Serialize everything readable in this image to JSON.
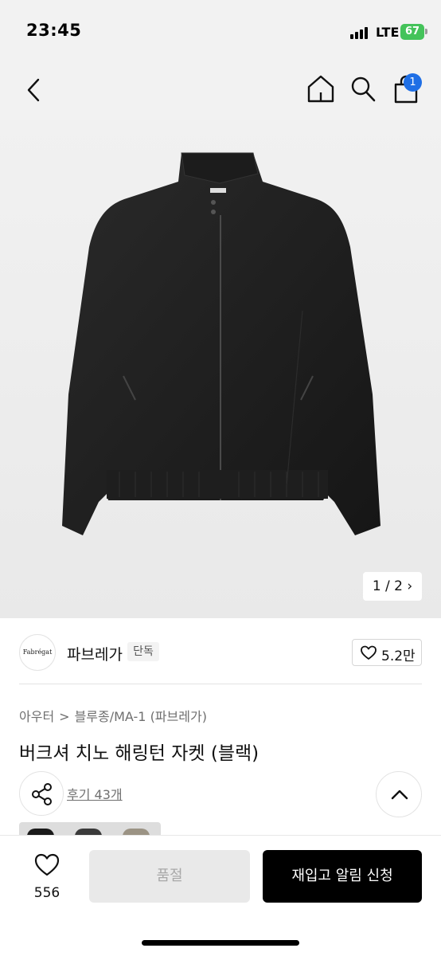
{
  "status_bar": {
    "time": "23:45",
    "network": "LTE",
    "battery": "67"
  },
  "nav": {
    "back_icon": "chevron-left-icon",
    "home_icon": "home-icon",
    "search_icon": "search-icon",
    "cart_icon": "shopping-bag-icon",
    "cart_badge": "1"
  },
  "product_image": {
    "counter": "1 / 2 ›"
  },
  "brand": {
    "logo_text": "Fabrégat",
    "name": "파브레가",
    "badge": "단독",
    "like_count": "5.2만"
  },
  "breadcrumb": [
    "아우터",
    "블루종/MA-1 (파브레가)"
  ],
  "breadcrumb_separator": ">",
  "product": {
    "title": "버크셔 치노 해링턴 자켓 (블랙)",
    "review_link": "후기 43개"
  },
  "actions": {
    "share_icon": "share-icon",
    "scroll_top_icon": "chevron-up-icon"
  },
  "bottom_bar": {
    "wish_icon": "heart-icon",
    "wish_count": "556",
    "soldout_label": "품절",
    "restock_label": "재입고 알림 신청"
  },
  "colors": {
    "accent_badge": "#1f6fe5",
    "battery": "#44c35a",
    "primary_button": "#000000",
    "disabled_button": "#e9e9e9"
  }
}
